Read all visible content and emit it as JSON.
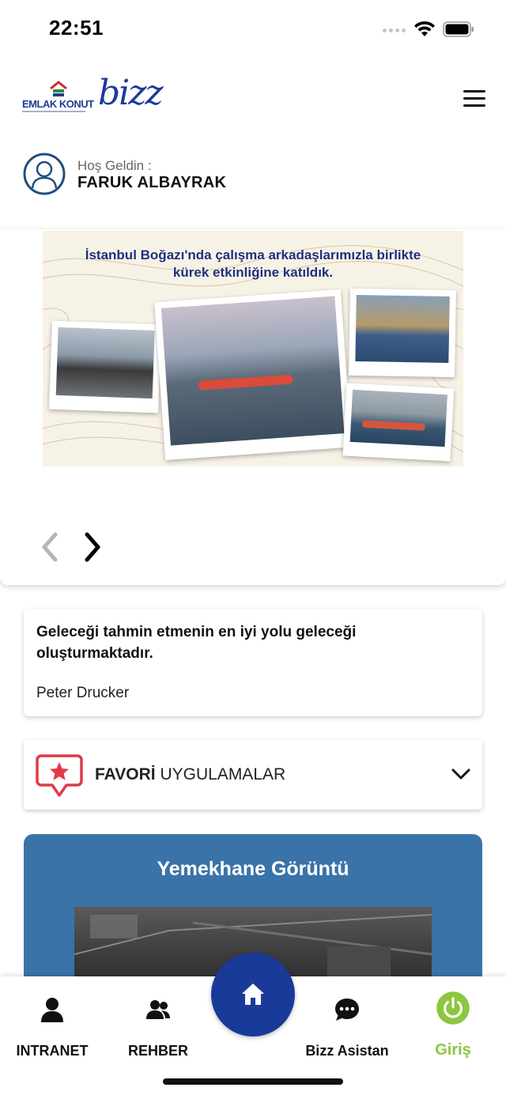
{
  "status_bar": {
    "time": "22:51"
  },
  "header": {
    "logo_emlak_text": "EMLAK KONUT",
    "logo_bizz_text": "bizz",
    "brand_color": "#1e3a9a"
  },
  "welcome": {
    "greeting": "Hoş Geldin :",
    "name": "FARUK ALBAYRAK"
  },
  "banner": {
    "title_line1": "İstanbul Boğazı'nda çalışma arkadaşlarımızla birlikte",
    "title_line2": "kürek etkinliğine katıldık."
  },
  "quote": {
    "text": "Geleceği tahmin etmenin en iyi yolu geleceği oluşturmaktadır.",
    "author": "Peter Drucker"
  },
  "favorites": {
    "label_bold": "FAVORİ",
    "label_rest": " UYGULAMALAR",
    "icon_color": "#e03a4a"
  },
  "dining": {
    "title": "Yemekhane Görüntü",
    "bg_color": "#3a73a8"
  },
  "tab_bar": {
    "items": [
      {
        "label": "INTRANET",
        "icon": "person-icon"
      },
      {
        "label": "REHBER",
        "icon": "people-icon"
      },
      {
        "label": "Bizz Asistan",
        "icon": "chat-icon"
      },
      {
        "label": "Giriş",
        "icon": "power-icon"
      }
    ],
    "home_icon": "home-icon",
    "home_color": "#1a3a9a",
    "giris_color": "#8dc63f"
  }
}
